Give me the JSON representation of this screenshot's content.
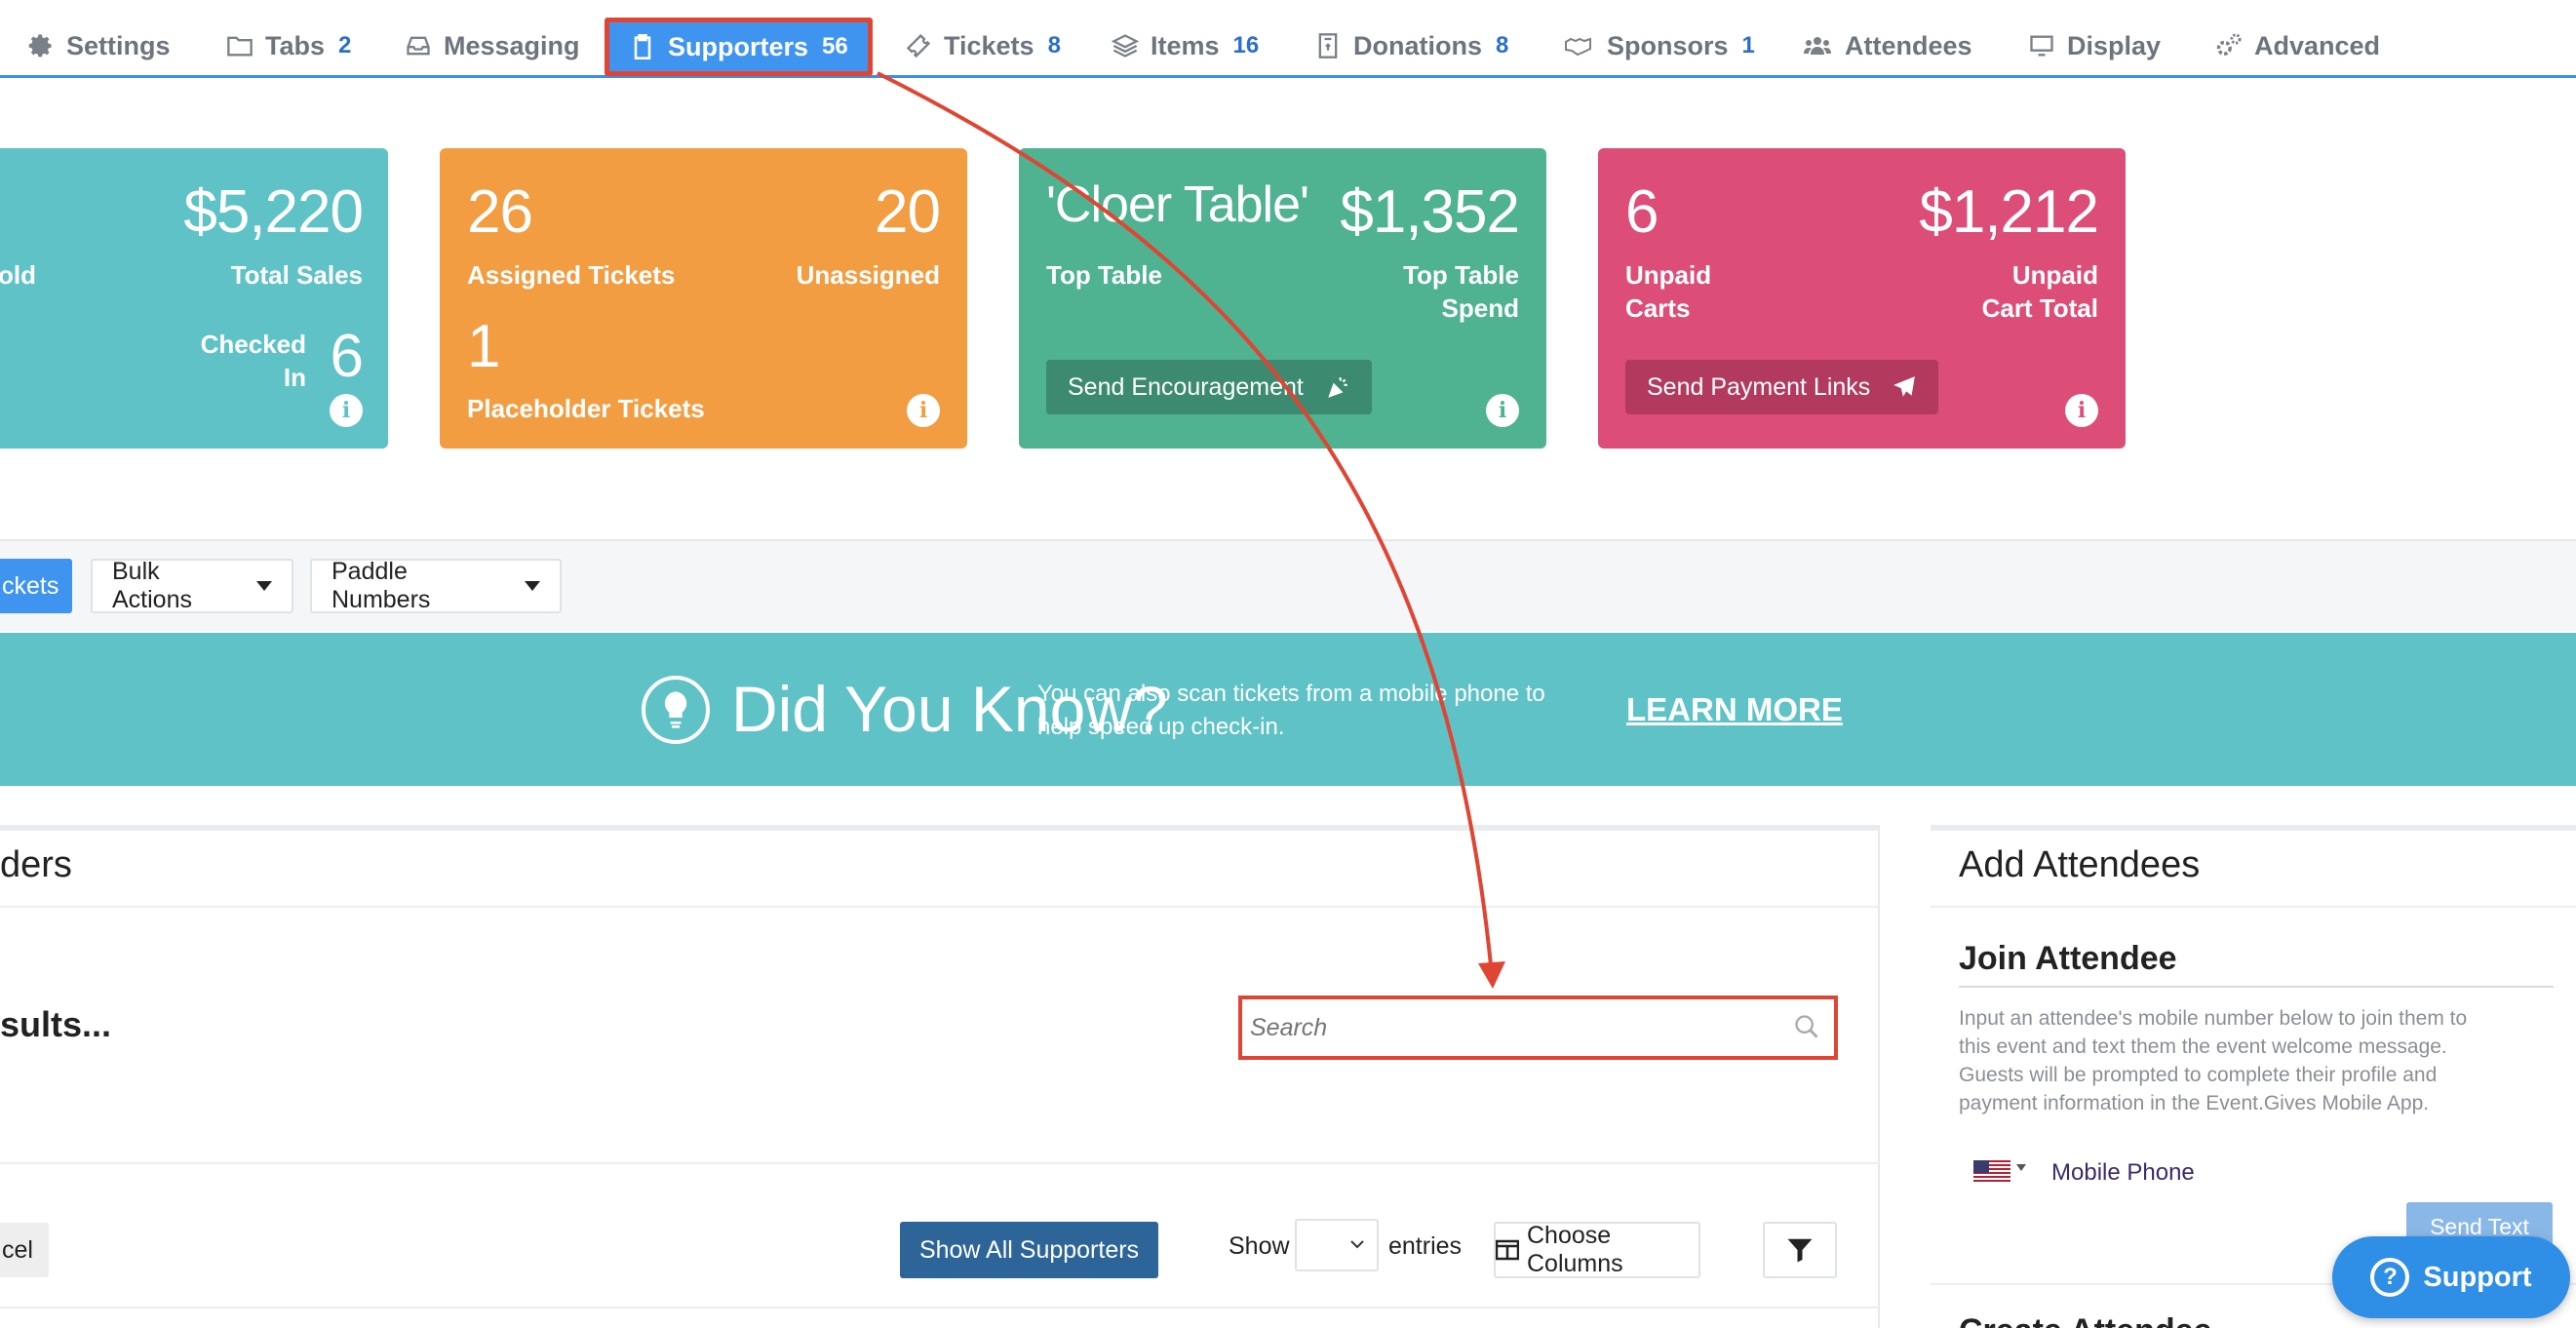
{
  "nav": {
    "tabs": [
      {
        "label": "Settings",
        "count": "",
        "icon": "gear-icon"
      },
      {
        "label": "Tabs",
        "count": "2",
        "icon": "folder-icon"
      },
      {
        "label": "Messaging",
        "count": "",
        "icon": "inbox-icon"
      },
      {
        "label": "Supporters",
        "count": "56",
        "icon": "clipboard-icon"
      },
      {
        "label": "Tickets",
        "count": "8",
        "icon": "ticket-icon"
      },
      {
        "label": "Items",
        "count": "16",
        "icon": "layers-icon"
      },
      {
        "label": "Donations",
        "count": "8",
        "icon": "donation-box-icon"
      },
      {
        "label": "Sponsors",
        "count": "1",
        "icon": "handshake-icon"
      },
      {
        "label": "Attendees",
        "count": "",
        "icon": "users-icon"
      },
      {
        "label": "Display",
        "count": "",
        "icon": "monitor-icon"
      },
      {
        "label": "Advanced",
        "count": "",
        "icon": "cogs-icon"
      }
    ],
    "active_tab": "Supporters"
  },
  "cards": {
    "sales": {
      "left_label": "old",
      "total_value": "$5,220",
      "total_label": "Total Sales",
      "checked_label_1": "Checked",
      "checked_label_2": "In",
      "checked_value": "6",
      "color": "#5fc2c6"
    },
    "tickets": {
      "assigned_value": "26",
      "assigned_label": "Assigned Tickets",
      "unassigned_value": "20",
      "unassigned_label": "Unassigned",
      "placeholder_value": "1",
      "placeholder_label": "Placeholder Tickets",
      "color": "#f39d43"
    },
    "table": {
      "top_name": "'Cloer Table'",
      "top_label": "Top Table",
      "spend_value": "$1,352",
      "spend_label_1": "Top Table",
      "spend_label_2": "Spend",
      "button_label": "Send Encouragement",
      "color": "#4fb291"
    },
    "carts": {
      "unpaid_value": "6",
      "unpaid_label_1": "Unpaid",
      "unpaid_label_2": "Carts",
      "total_value": "$1,212",
      "total_label_1": "Unpaid",
      "total_label_2": "Cart Total",
      "button_label": "Send Payment Links",
      "color": "#dc4e77"
    }
  },
  "toolbar": {
    "tickets_button": "ckets",
    "bulk_actions": "Bulk Actions",
    "paddle_numbers": "Paddle Numbers"
  },
  "did_you_know": {
    "title": "Did You Know?",
    "text_line1": "You can also scan tickets from a mobile phone to",
    "text_line2": "help speed up check-in.",
    "link": "LEARN MORE"
  },
  "supporters_panel": {
    "title": "ders",
    "results_label": "sults...",
    "search_placeholder": "Search",
    "cancel_label": "cel",
    "show_all_label": "Show All Supporters",
    "show_label": "Show",
    "entries_label": "entries",
    "choose_columns_label": "Choose Columns"
  },
  "attendees_panel": {
    "title": "Add Attendees",
    "subtitle": "Join Attendee",
    "description_1": "Input an attendee's mobile number below to join them to",
    "description_2": "this event and text them the event welcome message.",
    "description_3": "Guests will be prompted to complete their profile and",
    "description_4": "payment information in the Event.Gives Mobile App.",
    "phone_label": "Mobile Phone",
    "send_text_label": "Send Text",
    "next_heading": "Create Attendee"
  },
  "support_button": "Support",
  "colors": {
    "accent": "#3e94ee",
    "highlight": "#e04534",
    "dyk_bg": "#5fc2c6",
    "primary_button": "#2d6598"
  }
}
